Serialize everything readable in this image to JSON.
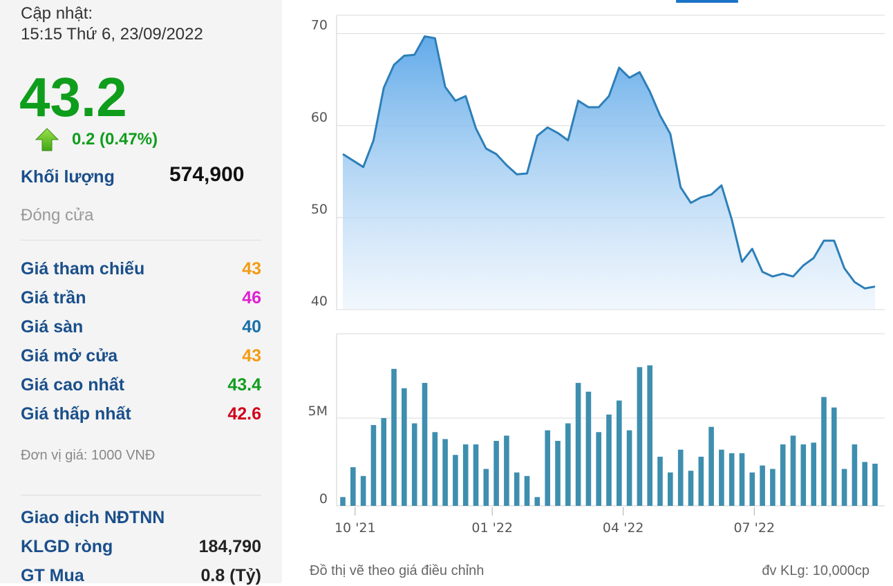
{
  "quote": {
    "update_label": "Cập nhật:",
    "update_time": "15:15 Thứ 6, 23/09/2022",
    "price": "43.2",
    "change": "0.2 (0.47%)",
    "volume_label": "Khối lượng",
    "volume": "574,900",
    "status": "Đóng cửa",
    "rows": [
      {
        "label": "Giá tham chiếu",
        "value": "43",
        "color": "#f39c12"
      },
      {
        "label": "Giá trần",
        "value": "46",
        "color": "#e020d0"
      },
      {
        "label": "Giá sàn",
        "value": "40",
        "color": "#1a6fa8"
      },
      {
        "label": "Giá mở cửa",
        "value": "43",
        "color": "#f39c12"
      },
      {
        "label": "Giá cao nhất",
        "value": "43.4",
        "color": "#0f9d1c"
      },
      {
        "label": "Giá thấp nhất",
        "value": "42.6",
        "color": "#d0021b"
      }
    ],
    "unit_note": "Đơn vị giá: 1000 VNĐ",
    "foreign_title": "Giao dịch NĐTNN",
    "net_vol_label": "KLGD ròng",
    "net_vol": "184,790",
    "buy_label": "GT Mua",
    "buy_value": "0.8 (Tỷ)"
  },
  "footer": {
    "left_note": "Đồ thị vẽ theo giá điều chỉnh",
    "right_note": "đv KLg: 10,000cp"
  },
  "chart_data": [
    {
      "type": "area",
      "y_ticks": [
        "40",
        "50",
        "60",
        "70"
      ],
      "ylim": [
        40,
        72
      ],
      "x_ticks": [
        "10 '21",
        "01 '22",
        "04 '22",
        "07 '22"
      ],
      "values": [
        56.9,
        56.2,
        55.5,
        58.4,
        64.1,
        66.6,
        67.6,
        67.7,
        69.7,
        69.5,
        64.2,
        62.7,
        63.2,
        59.7,
        57.5,
        56.9,
        55.7,
        54.7,
        54.8,
        58.9,
        59.8,
        59.2,
        58.4,
        62.7,
        62.0,
        62.0,
        63.2,
        66.3,
        65.2,
        65.8,
        63.7,
        61.1,
        59.1,
        53.3,
        51.6,
        52.2,
        52.5,
        53.5,
        49.8,
        45.2,
        46.6,
        44.1,
        43.6,
        43.9,
        43.6,
        44.8,
        45.6,
        47.5,
        47.5,
        44.5,
        43.0,
        42.3,
        42.5
      ],
      "grid": true
    },
    {
      "type": "bar",
      "y_ticks": [
        "0",
        "5M"
      ],
      "ylim": [
        0,
        9.8
      ],
      "values": [
        0.5,
        2.2,
        1.7,
        4.6,
        5.0,
        7.8,
        6.7,
        4.7,
        7.0,
        4.2,
        3.8,
        2.9,
        3.5,
        3.5,
        2.1,
        3.7,
        4.0,
        1.9,
        1.7,
        0.5,
        4.3,
        3.7,
        4.7,
        7.0,
        6.5,
        4.2,
        5.2,
        6.0,
        4.3,
        7.9,
        8.0,
        2.8,
        1.9,
        3.2,
        2.0,
        2.8,
        4.5,
        3.2,
        3.0,
        3.0,
        1.9,
        2.3,
        2.1,
        3.5,
        4.0,
        3.5,
        3.6,
        6.2,
        5.6,
        2.1,
        3.5,
        2.5,
        2.4
      ],
      "grid": true
    }
  ]
}
